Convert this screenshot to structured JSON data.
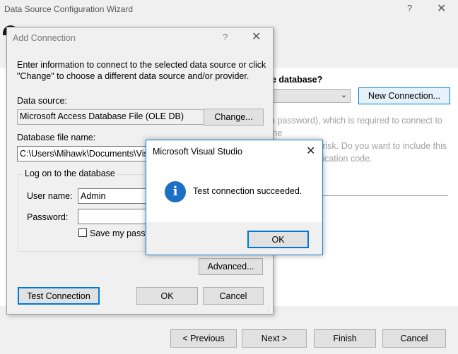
{
  "wizard": {
    "title": "Data Source Configuration Wizard",
    "help_glyph": "?",
    "close_glyph": "✕",
    "question": "e database?",
    "new_connection_label": "New Connection...",
    "text_line1": "n password), which is required to connect to the",
    "text_line2": "be a security risk. Do you want to include this",
    "text_line3": "on in my application code.",
    "buttons": {
      "previous": "< Previous",
      "next": "Next >",
      "finish": "Finish",
      "cancel": "Cancel"
    }
  },
  "add_connection": {
    "title": "Add Connection",
    "help_glyph": "?",
    "close_glyph": "✕",
    "instruction": "Enter information to connect to the selected data source or click \"Change\" to choose a different data source and/or provider.",
    "data_source_label": "Data source:",
    "data_source_value": "Microsoft Access Database File (OLE DB)",
    "change_label": "Change...",
    "db_file_label": "Database file name:",
    "db_file_value": "C:\\Users\\Mihawk\\Documents\\Visu",
    "logon_group_label": "Log on to the database",
    "username_label": "User name:",
    "username_value": "Admin",
    "password_label": "Password:",
    "password_value": "",
    "save_password_label": "Save my passw",
    "advanced_label": "Advanced...",
    "test_connection_label": "Test Connection",
    "ok_label": "OK",
    "cancel_label": "Cancel"
  },
  "message_box": {
    "title": "Microsoft Visual Studio",
    "close_glyph": "✕",
    "icon_glyph": "i",
    "message": "Test connection succeeded.",
    "ok_label": "OK"
  },
  "colors": {
    "accent": "#0078d7",
    "info_icon": "#1c6fc3"
  }
}
